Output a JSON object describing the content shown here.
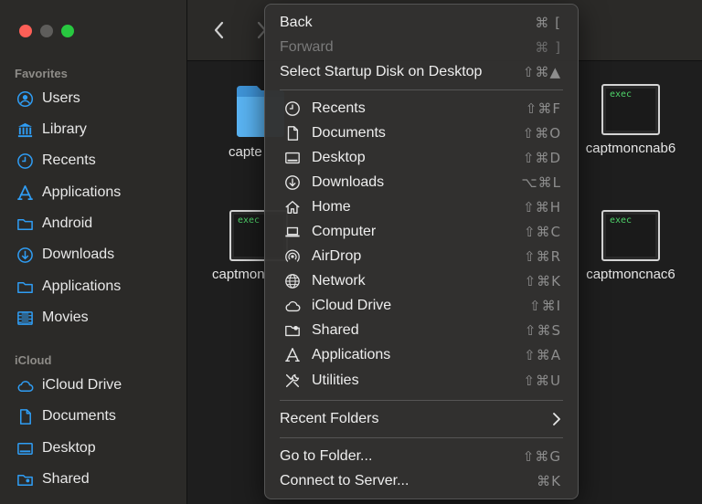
{
  "colors": {
    "close": "#fe5f57",
    "minimize": "#5e5d5b",
    "zoom": "#28c840",
    "accent": "#2f9df4",
    "folder": "#5ab4f3",
    "exec_text": "#4fd46a"
  },
  "sidebar": {
    "favorites_title": "Favorites",
    "favorites": [
      {
        "label": "Users",
        "icon": "user-circle-icon"
      },
      {
        "label": "Library",
        "icon": "library-icon"
      },
      {
        "label": "Recents",
        "icon": "clock-icon"
      },
      {
        "label": "Applications",
        "icon": "applications-icon"
      },
      {
        "label": "Android",
        "icon": "folder-icon"
      },
      {
        "label": "Downloads",
        "icon": "download-icon"
      },
      {
        "label": "Applications",
        "icon": "folder-icon"
      },
      {
        "label": "Movies",
        "icon": "film-icon"
      }
    ],
    "icloud_title": "iCloud",
    "icloud": [
      {
        "label": "iCloud Drive",
        "icon": "cloud-icon"
      },
      {
        "label": "Documents",
        "icon": "document-icon"
      },
      {
        "label": "Desktop",
        "icon": "desktop-icon"
      },
      {
        "label": "Shared",
        "icon": "shared-folder-icon"
      }
    ]
  },
  "files": [
    {
      "name": "capte",
      "kind": "folder"
    },
    {
      "name": "captmoncnab6",
      "kind": "exec",
      "badge": "exec"
    },
    {
      "name": "captmon",
      "kind": "exec",
      "badge": "exec"
    },
    {
      "name": "captmoncnac6",
      "kind": "exec",
      "badge": "exec"
    }
  ],
  "menu": {
    "back": {
      "label": "Back",
      "shortcut": "⌘ ["
    },
    "forward": {
      "label": "Forward",
      "shortcut": "⌘ ]"
    },
    "startup": {
      "label": "Select Startup Disk on Desktop",
      "shortcut": "⇧⌘▲"
    },
    "places": [
      {
        "label": "Recents",
        "shortcut": "⇧⌘F",
        "icon": "clock-icon"
      },
      {
        "label": "Documents",
        "shortcut": "⇧⌘O",
        "icon": "document-icon"
      },
      {
        "label": "Desktop",
        "shortcut": "⇧⌘D",
        "icon": "desktop-icon"
      },
      {
        "label": "Downloads",
        "shortcut": "⌥⌘L",
        "icon": "download-icon"
      },
      {
        "label": "Home",
        "shortcut": "⇧⌘H",
        "icon": "home-icon"
      },
      {
        "label": "Computer",
        "shortcut": "⇧⌘C",
        "icon": "laptop-icon"
      },
      {
        "label": "AirDrop",
        "shortcut": "⇧⌘R",
        "icon": "airdrop-icon"
      },
      {
        "label": "Network",
        "shortcut": "⇧⌘K",
        "icon": "globe-icon"
      },
      {
        "label": "iCloud Drive",
        "shortcut": "⇧⌘I",
        "icon": "cloud-icon"
      },
      {
        "label": "Shared",
        "shortcut": "⇧⌘S",
        "icon": "shared-folder-icon"
      },
      {
        "label": "Applications",
        "shortcut": "⇧⌘A",
        "icon": "applications-icon"
      },
      {
        "label": "Utilities",
        "shortcut": "⇧⌘U",
        "icon": "tools-icon"
      }
    ],
    "recent_folders": "Recent Folders",
    "go_to_folder": {
      "label": "Go to Folder...",
      "shortcut": "⇧⌘G"
    },
    "connect": {
      "label": "Connect to Server...",
      "shortcut": "⌘K"
    }
  }
}
